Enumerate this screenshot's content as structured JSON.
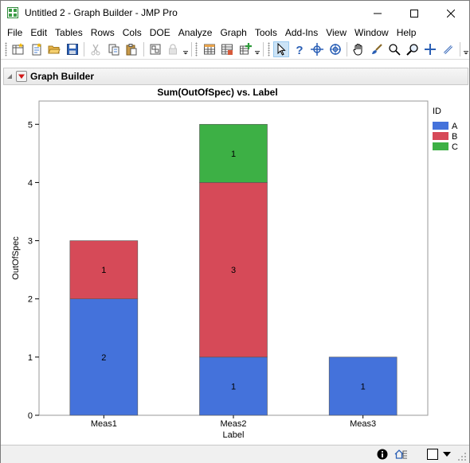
{
  "window": {
    "title": "Untitled 2 - Graph Builder - JMP Pro"
  },
  "menu": [
    "File",
    "Edit",
    "Tables",
    "Rows",
    "Cols",
    "DOE",
    "Analyze",
    "Graph",
    "Tools",
    "Add-Ins",
    "View",
    "Window",
    "Help"
  ],
  "toolbar_icons": [
    "new-table-icon",
    "new-script-icon",
    "open-icon",
    "save-icon",
    "cut-icon",
    "copy-icon",
    "paste-icon",
    "journal-icon",
    "lock-icon",
    "dropdown-icon",
    "data-table-icon",
    "open-data-icon",
    "add-table-icon",
    "dropdown-icon",
    "arrow-tool-icon",
    "help-tool-icon",
    "crosshair-tool-icon",
    "lasso-tool-icon",
    "hand-tool-icon",
    "brush-tool-icon",
    "selection-tool-icon",
    "magnifier-tool-icon",
    "plus-tool-icon",
    "line-tool-icon",
    "dropdown-icon"
  ],
  "report": {
    "title": "Graph Builder"
  },
  "chart_data": {
    "type": "bar",
    "title": "Sum(OutOfSpec) vs. Label",
    "xlabel": "Label",
    "ylabel": "OutOfSpec",
    "categories": [
      "Meas1",
      "Meas2",
      "Meas3"
    ],
    "stacked": true,
    "ylim": [
      0,
      5.4
    ],
    "yticks": [
      "0",
      "1",
      "2",
      "3",
      "4",
      "5"
    ],
    "legend_title": "ID",
    "legend_position": "right",
    "series": [
      {
        "name": "A",
        "color": "#4472db",
        "values": [
          2,
          1,
          1
        ],
        "labels": [
          "2",
          "1",
          "1"
        ]
      },
      {
        "name": "B",
        "color": "#d64a58",
        "values": [
          1,
          3,
          0
        ],
        "labels": [
          "1",
          "3",
          ""
        ]
      },
      {
        "name": "C",
        "color": "#3db045",
        "values": [
          0,
          1,
          0
        ],
        "labels": [
          "",
          "1",
          ""
        ]
      }
    ]
  }
}
